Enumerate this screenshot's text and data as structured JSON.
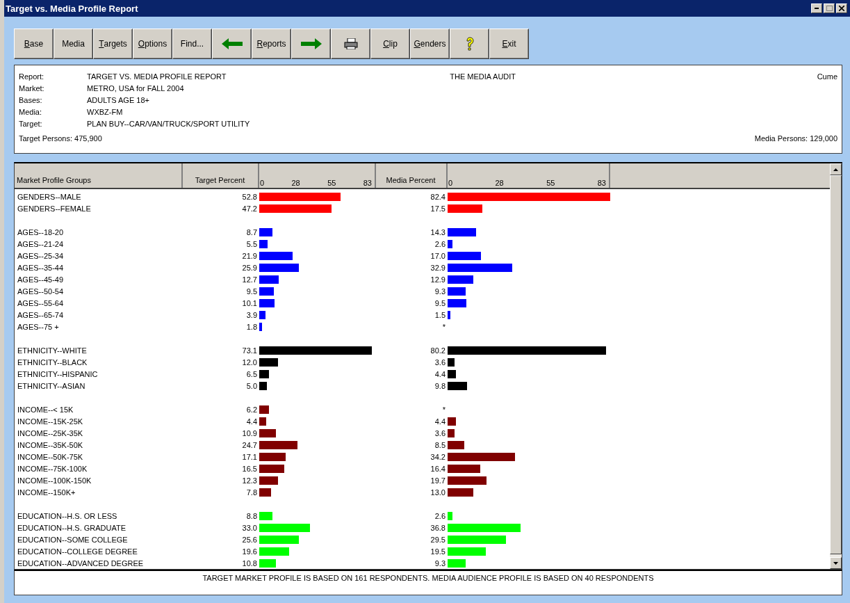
{
  "window": {
    "title": "Target vs. Media Profile Report"
  },
  "toolbar": [
    {
      "kind": "text",
      "label": "Base",
      "underlined": true
    },
    {
      "kind": "text",
      "label": "Media",
      "underlined": false
    },
    {
      "kind": "text",
      "label": "Targets",
      "underlined": true
    },
    {
      "kind": "text",
      "label": "Options",
      "underlined": true
    },
    {
      "kind": "text",
      "label": "Find...",
      "underlined": false
    },
    {
      "kind": "back"
    },
    {
      "kind": "text",
      "label": "Reports",
      "underlined": true
    },
    {
      "kind": "forward"
    },
    {
      "kind": "print"
    },
    {
      "kind": "text",
      "label": "Clip",
      "underlined": true
    },
    {
      "kind": "text",
      "label": "Genders",
      "underlined": true
    },
    {
      "kind": "help"
    },
    {
      "kind": "text",
      "label": "Exit",
      "underlined": true
    }
  ],
  "header": {
    "fields": [
      {
        "label": "Report:",
        "value": "TARGET VS. MEDIA PROFILE REPORT"
      },
      {
        "label": "Market:",
        "value": "METRO, USA for FALL 2004"
      },
      {
        "label": "Bases:",
        "value": "ADULTS AGE 18+"
      },
      {
        "label": "Media:",
        "value": "WXBZ-FM"
      },
      {
        "label": "Target:",
        "value": "PLAN BUY--CAR/VAN/TRUCK/SPORT UTILITY"
      }
    ],
    "source": "THE MEDIA AUDIT",
    "mode": "Cume",
    "target_persons": "Target Persons: 475,900",
    "media_persons": "Media Persons: 129,000"
  },
  "table": {
    "columns": [
      "Market Profile Groups",
      "Target Percent",
      "Media Percent"
    ],
    "target_axis_ticks": [
      "0",
      "28",
      "55",
      "83"
    ],
    "media_axis_ticks": [
      "0",
      "28",
      "55",
      "83"
    ],
    "groups": [
      {
        "color": "#ff0000",
        "rows": [
          {
            "label": "GENDERS--MALE",
            "target": "52.8",
            "media": "82.4"
          },
          {
            "label": "GENDERS--FEMALE",
            "target": "47.2",
            "media": "17.5"
          }
        ]
      },
      {
        "color": "#0000ff",
        "rows": [
          {
            "label": "AGES--18-20",
            "target": "8.7",
            "media": "14.3"
          },
          {
            "label": "AGES--21-24",
            "target": "5.5",
            "media": "2.6"
          },
          {
            "label": "AGES--25-34",
            "target": "21.9",
            "media": "17.0"
          },
          {
            "label": "AGES--35-44",
            "target": "25.9",
            "media": "32.9"
          },
          {
            "label": "AGES--45-49",
            "target": "12.7",
            "media": "12.9"
          },
          {
            "label": "AGES--50-54",
            "target": "9.5",
            "media": "9.3"
          },
          {
            "label": "AGES--55-64",
            "target": "10.1",
            "media": "9.5"
          },
          {
            "label": "AGES--65-74",
            "target": "3.9",
            "media": "1.5"
          },
          {
            "label": "AGES--75 +",
            "target": "1.8",
            "media": "*"
          }
        ]
      },
      {
        "color": "#000000",
        "rows": [
          {
            "label": "ETHNICITY--WHITE",
            "target": "73.1",
            "media": "80.2"
          },
          {
            "label": "ETHNICITY--BLACK",
            "target": "12.0",
            "media": "3.6"
          },
          {
            "label": "ETHNICITY--HISPANIC",
            "target": "6.5",
            "media": "4.4"
          },
          {
            "label": "ETHNICITY--ASIAN",
            "target": "5.0",
            "media": "9.8"
          }
        ]
      },
      {
        "color": "#800000",
        "rows": [
          {
            "label": "INCOME--< 15K",
            "target": "6.2",
            "media": "*"
          },
          {
            "label": "INCOME--15K-25K",
            "target": "4.4",
            "media": "4.4"
          },
          {
            "label": "INCOME--25K-35K",
            "target": "10.9",
            "media": "3.6"
          },
          {
            "label": "INCOME--35K-50K",
            "target": "24.7",
            "media": "8.5"
          },
          {
            "label": "INCOME--50K-75K",
            "target": "17.1",
            "media": "34.2"
          },
          {
            "label": "INCOME--75K-100K",
            "target": "16.5",
            "media": "16.4"
          },
          {
            "label": "INCOME--100K-150K",
            "target": "12.3",
            "media": "19.7"
          },
          {
            "label": "INCOME--150K+",
            "target": "7.8",
            "media": "13.0"
          }
        ]
      },
      {
        "color": "#00ff00",
        "rows": [
          {
            "label": "EDUCATION--H.S. OR LESS",
            "target": "8.8",
            "media": "2.6"
          },
          {
            "label": "EDUCATION--H.S. GRADUATE",
            "target": "33.0",
            "media": "36.8"
          },
          {
            "label": "EDUCATION--SOME COLLEGE",
            "target": "25.6",
            "media": "29.5"
          },
          {
            "label": "EDUCATION--COLLEGE DEGREE",
            "target": "19.6",
            "media": "19.5"
          },
          {
            "label": "EDUCATION--ADVANCED DEGREE",
            "target": "10.8",
            "media": "9.3"
          }
        ]
      }
    ]
  },
  "footer": "TARGET MARKET PROFILE IS BASED ON 161 RESPONDENTS.  MEDIA AUDIENCE PROFILE IS BASED ON 40 RESPONDENTS"
}
